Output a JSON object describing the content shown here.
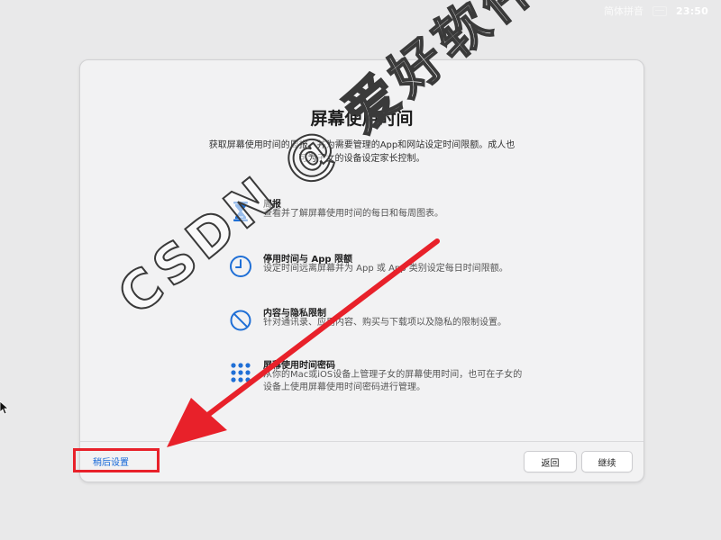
{
  "menubar": {
    "input_source": "简体拼音",
    "input_icon": "keyboard-icon",
    "clock": "23:50"
  },
  "window": {
    "title": "屏幕使用时间",
    "subtitle": "获取屏幕使用时间的周报，并为需要管理的App和网站设定时间限额。成人也可为子女的设备设定家长控制。",
    "features": [
      {
        "icon": "hourglass-icon",
        "title": "周报",
        "description": "查看并了解屏幕使用时间的每日和每周图表。"
      },
      {
        "icon": "clock-icon",
        "title": "停用时间与 App 限额",
        "description": "设定时间远离屏幕并为 App 或 App 类别设定每日时间限额。"
      },
      {
        "icon": "no-entry-icon",
        "title": "内容与隐私限制",
        "description": "针对通讯录、应用内容、购买与下载项以及隐私的限制设置。"
      },
      {
        "icon": "keypad-icon",
        "title": "屏幕使用时间密码",
        "description": "从你的Mac或iOS设备上管理子女的屏幕使用时间，也可在子女的设备上使用屏幕使用时间密码进行管理。"
      }
    ],
    "later_label": "稍后设置",
    "back_label": "返回",
    "continue_label": "继续"
  },
  "annotation": {
    "highlight_color": "#e8212a",
    "watermark_text": "CSDN @ 爱好软件"
  }
}
